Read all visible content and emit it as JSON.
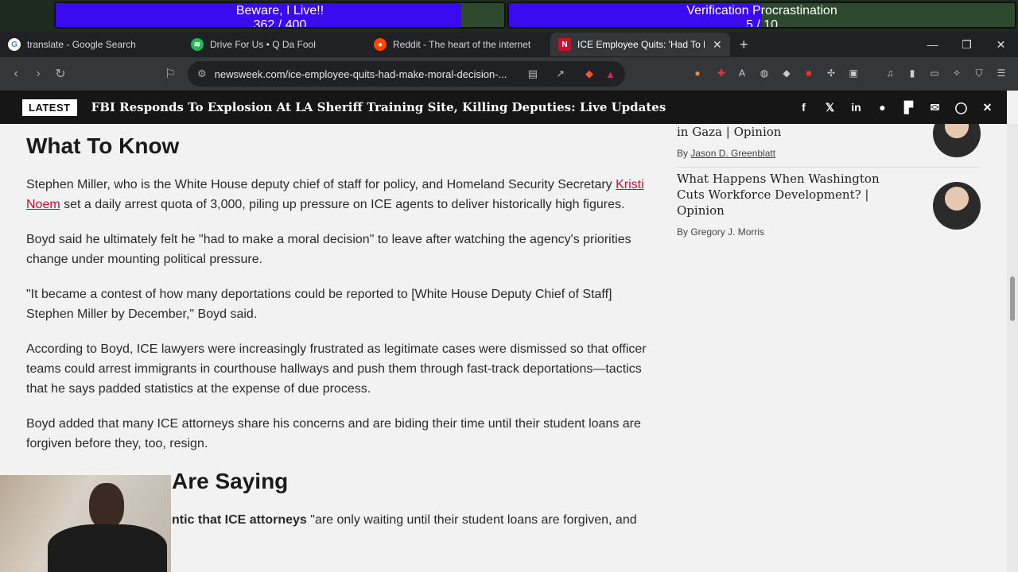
{
  "overlay": {
    "bar1": {
      "line1": "Beware, I Live!!",
      "line2": "362 / 400",
      "fill_fraction": 0.905
    },
    "bar2": {
      "line1": "Verification Procrastination",
      "line2": "5 / 10",
      "fill_fraction": 0.5
    }
  },
  "tabs": [
    {
      "label": "translate - Google Search",
      "icon": "google-icon"
    },
    {
      "label": "Drive For Us • Q Da Fool",
      "icon": "spotify-icon"
    },
    {
      "label": "Reddit - The heart of the internet",
      "icon": "reddit-icon"
    },
    {
      "label": "ICE Employee Quits: 'Had To Ma",
      "icon": "newsweek-icon",
      "active": true
    }
  ],
  "address": {
    "url": "newsweek.com/ice-employee-quits-had-make-moral-decision-..."
  },
  "latest": {
    "badge": "LATEST",
    "headline": "FBI Responds To Explosion At LA Sheriff Training Site, Killing Deputies: Live Updates"
  },
  "article": {
    "heading": "What To Know",
    "p1_before": "Stephen Miller, who is the White House deputy chief of staff for policy, and Homeland Security Secretary ",
    "p1_link": "Kristi Noem",
    "p1_after": " set a daily arrest quota of 3,000, piling up pressure on ICE agents to deliver historically high figures.",
    "p2": "Boyd said he ultimately felt he \"had to make a moral decision\" to leave after watching the agency's priorities change under mounting political pressure.",
    "p3": "\"It became a contest of how many deportations could be reported to [White House Deputy Chief of Staff] Stephen Miller by December,\" Boyd said.",
    "p4": "According to Boyd, ICE lawyers were increasingly frustrated as legitimate cases were dismissed so that officer teams could arrest immigrants in courthouse hallways and push them through fast-track deportations—tactics that he says padded statistics at the expense of due process.",
    "p5": "Boyd added that many ICE attorneys share his concerns and are biding their time until their student loans are forgiven before they, too, resign.",
    "heading2": "Are Saying",
    "p6_bold": "ntic that ICE attorneys",
    "p6_rest": " \"are only waiting until their student loans are forgiven, and"
  },
  "sidebar": [
    {
      "title": "in Gaza | Opinion",
      "by_prefix": "By ",
      "author": "Jason D. Greenblatt"
    },
    {
      "title": "What Happens When Washington Cuts Workforce Development? | Opinion",
      "by_prefix": "By ",
      "author": "Gregory J. Morris"
    }
  ],
  "colors": {
    "accent": "#c8102e",
    "overlay_fill": "#3a0af0",
    "latest_bar": "#161616"
  }
}
